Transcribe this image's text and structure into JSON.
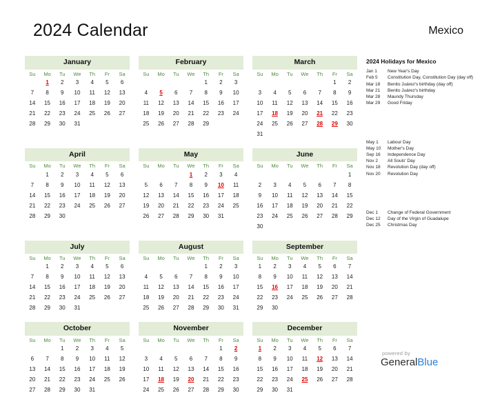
{
  "header": {
    "title": "2024 Calendar",
    "country": "Mexico"
  },
  "weekday_headers": [
    "Su",
    "Mo",
    "Tu",
    "We",
    "Th",
    "Fr",
    "Sa"
  ],
  "calendar": {
    "year": 2024,
    "accent_holiday_color": "#e00000",
    "month_header_bg": "#e2ecd7",
    "weekday_color": "#4a8a3a",
    "months": [
      {
        "name": "January",
        "lead_blanks": 1,
        "days": 31,
        "holidays": [
          1
        ]
      },
      {
        "name": "February",
        "lead_blanks": 4,
        "days": 29,
        "holidays": [
          5
        ]
      },
      {
        "name": "March",
        "lead_blanks": 5,
        "days": 31,
        "holidays": [
          18,
          21,
          28,
          29
        ]
      },
      {
        "name": "April",
        "lead_blanks": 1,
        "days": 30,
        "holidays": []
      },
      {
        "name": "May",
        "lead_blanks": 3,
        "days": 31,
        "holidays": [
          1,
          10
        ]
      },
      {
        "name": "June",
        "lead_blanks": 6,
        "days": 30,
        "holidays": []
      },
      {
        "name": "July",
        "lead_blanks": 1,
        "days": 31,
        "holidays": []
      },
      {
        "name": "August",
        "lead_blanks": 4,
        "days": 31,
        "holidays": []
      },
      {
        "name": "September",
        "lead_blanks": 0,
        "days": 30,
        "holidays": [
          16
        ]
      },
      {
        "name": "October",
        "lead_blanks": 2,
        "days": 31,
        "holidays": []
      },
      {
        "name": "November",
        "lead_blanks": 5,
        "days": 30,
        "holidays": [
          2,
          18,
          20
        ]
      },
      {
        "name": "December",
        "lead_blanks": 0,
        "days": 31,
        "holidays": [
          1,
          12,
          25
        ]
      }
    ]
  },
  "holidays_panel": {
    "title": "2024 Holidays for Mexico",
    "groups": [
      {
        "entries": [
          {
            "date": "Jan 1",
            "name": "New Year's Day"
          },
          {
            "date": "Feb 5",
            "name": "Constitution Day, Constitution Day (day off)"
          },
          {
            "date": "Mar 18",
            "name": "Benito Juárez's birthday (day off)"
          },
          {
            "date": "Mar 21",
            "name": "Benito Juárez's birthday"
          },
          {
            "date": "Mar 28",
            "name": "Maundy Thursday"
          },
          {
            "date": "Mar 29",
            "name": "Good Friday"
          }
        ]
      },
      {
        "entries": [
          {
            "date": "May 1",
            "name": "Labour Day"
          },
          {
            "date": "May 10",
            "name": "Mother's Day"
          },
          {
            "date": "Sep 16",
            "name": "Independence Day"
          },
          {
            "date": "Nov 2",
            "name": "All Souls' Day"
          },
          {
            "date": "Nov 18",
            "name": "Revolution Day (day off)"
          },
          {
            "date": "Nov 20",
            "name": "Revolution Day"
          }
        ]
      },
      {
        "entries": [
          {
            "date": "Dec 1",
            "name": "Change of Federal Government"
          },
          {
            "date": "Dec 12",
            "name": "Day of the Virgin of Guadalupe"
          },
          {
            "date": "Dec 25",
            "name": "Christmas Day"
          }
        ]
      }
    ]
  },
  "footer": {
    "powered_by": "powered by",
    "brand_first": "General",
    "brand_second": "Blue",
    "brand_color": "#2a7fd4"
  }
}
